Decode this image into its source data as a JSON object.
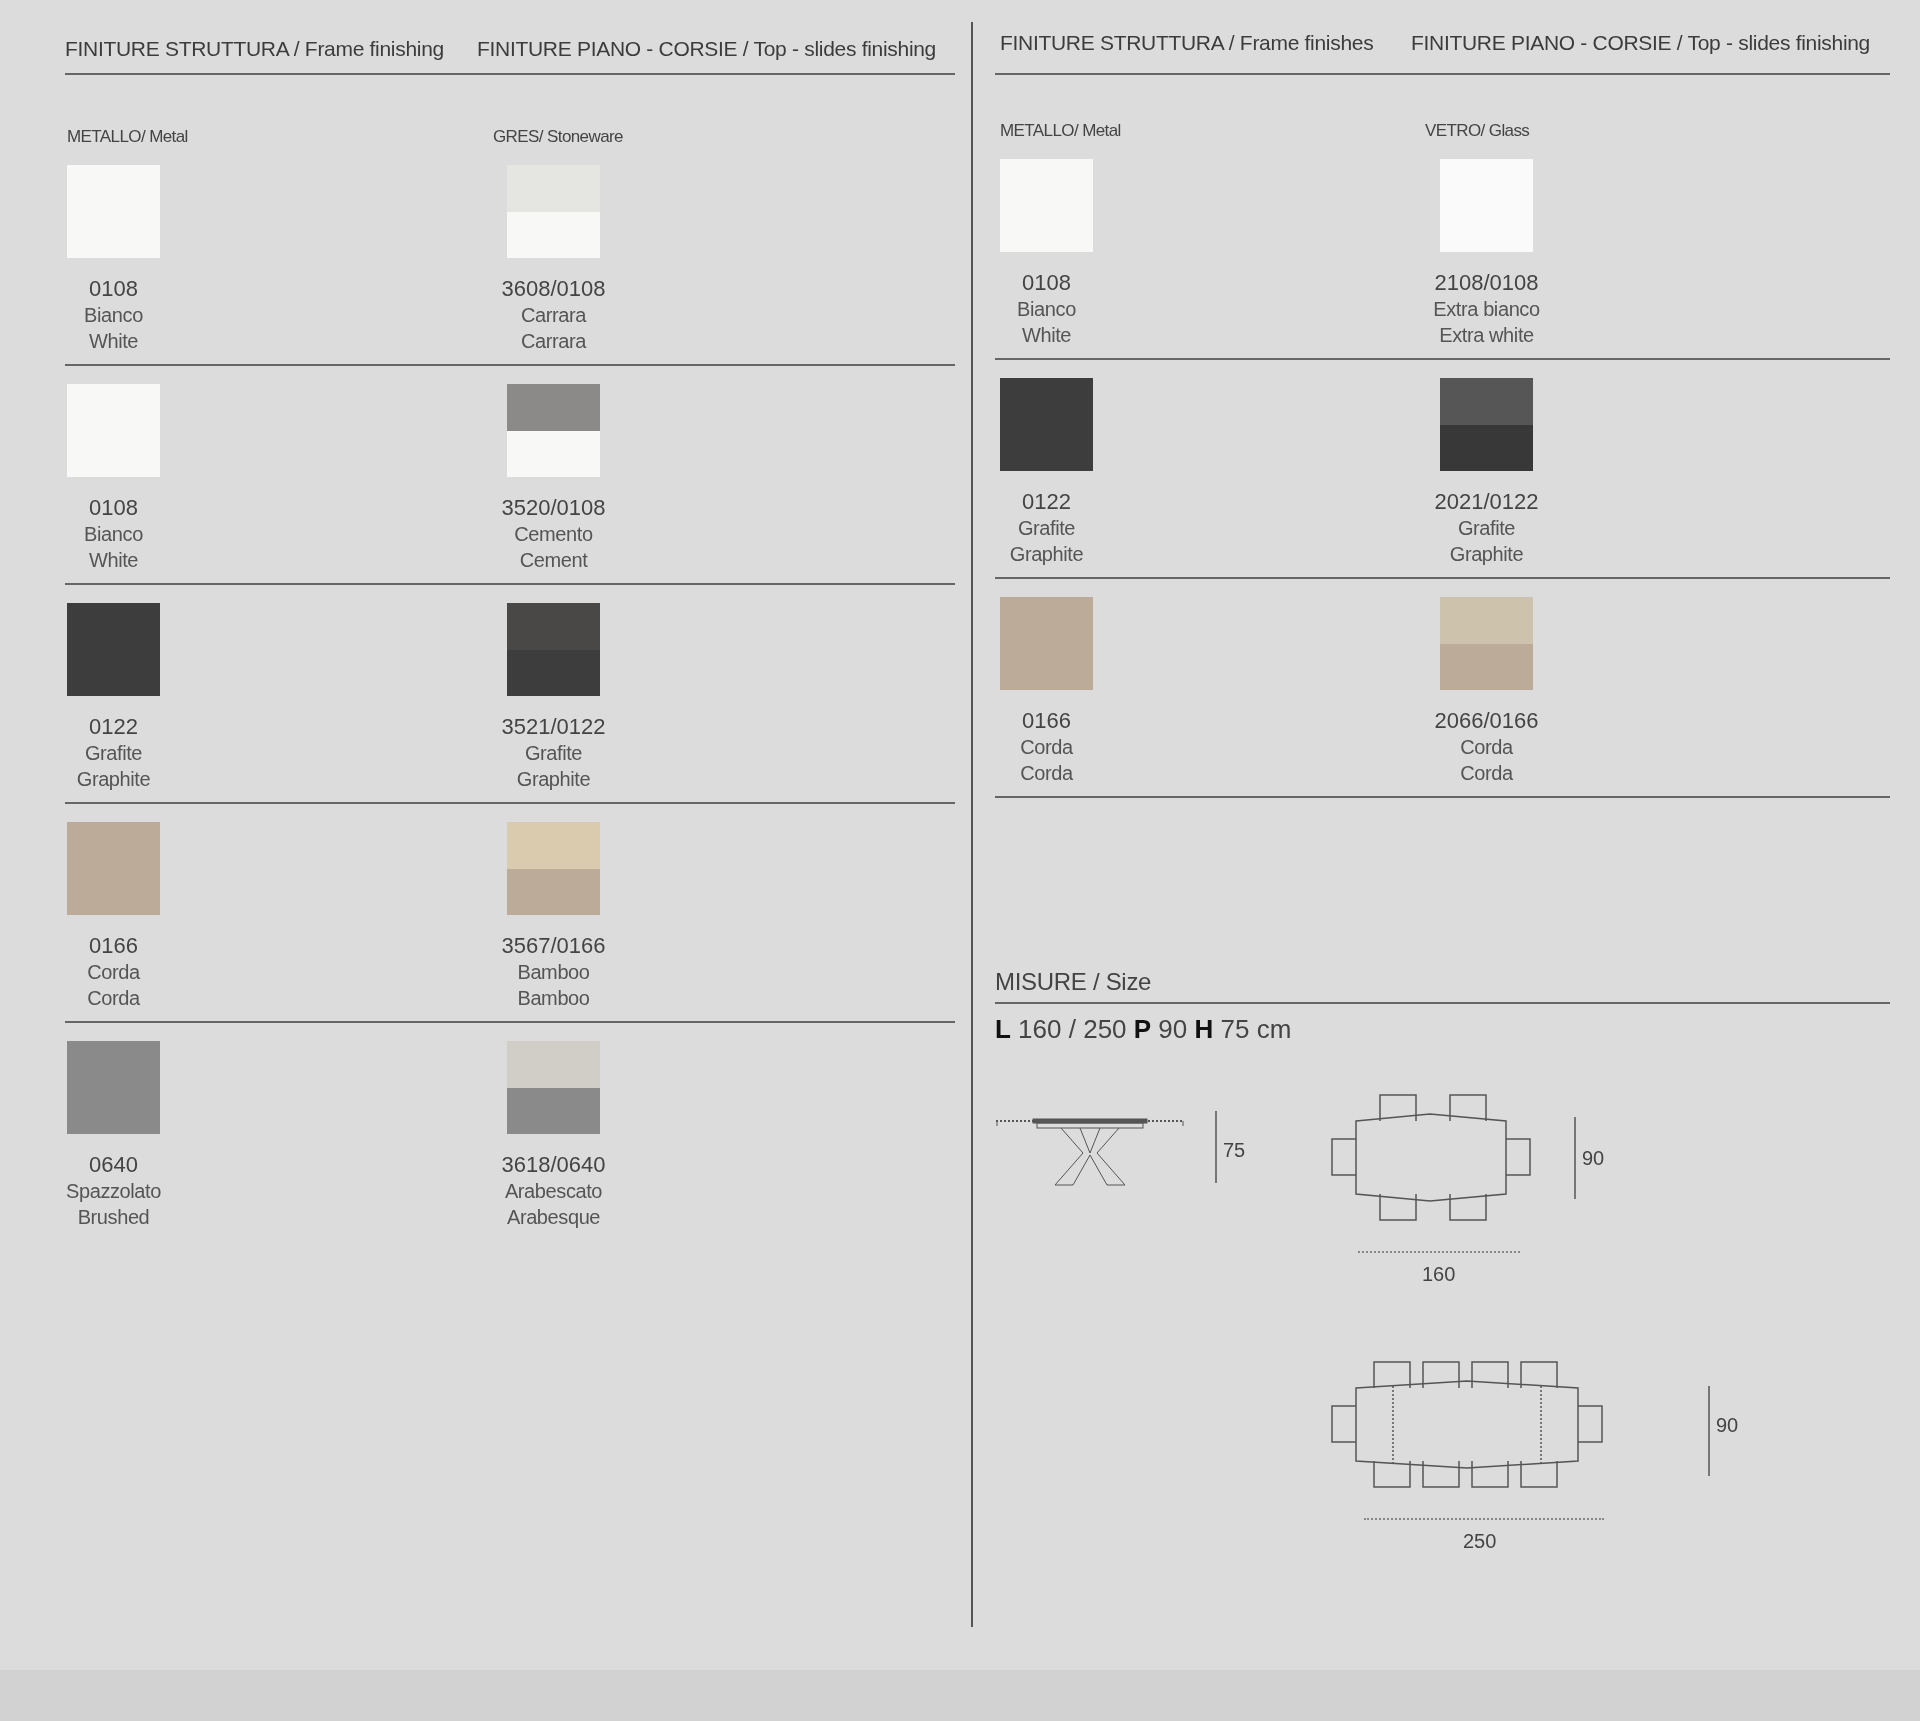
{
  "panels": [
    {
      "headings": [
        "FINITURE STRUTTURA / Frame finishing",
        "FINITURE PIANO - CORSIE / Top - slides finishing"
      ],
      "materials": [
        "METALLO/ Metal",
        "GRES/ Stoneware"
      ],
      "rows": [
        {
          "cells": [
            {
              "kind": "solid",
              "code": "0108",
              "name_it": "Bianco",
              "name_en": "White",
              "color": "#f8f8f7"
            },
            {
              "kind": "split",
              "code": "3608/0108",
              "name_it": "Carrara",
              "name_en": "Carrara",
              "halves": [
                {
                  "color": "#e5e5e1"
                },
                {
                  "color": "#f8f8f7"
                }
              ]
            }
          ]
        },
        {
          "cells": [
            {
              "kind": "solid",
              "code": "0108",
              "name_it": "Bianco",
              "name_en": "White",
              "color": "#f8f8f7"
            },
            {
              "kind": "split",
              "code": "3520/0108",
              "name_it": "Cemento",
              "name_en": "Cement",
              "halves": [
                {
                  "color": "#8b8a88"
                },
                {
                  "color": "#f8f8f7"
                }
              ]
            }
          ]
        },
        {
          "cells": [
            {
              "kind": "solid",
              "code": "0122",
              "name_it": "Grafite",
              "name_en": "Graphite",
              "color": "#3d3d3d"
            },
            {
              "kind": "split",
              "code": "3521/0122",
              "name_it": "Grafite",
              "name_en": "Graphite",
              "halves": [
                {
                  "color": "#4a4846"
                },
                {
                  "color": "#3d3d3d"
                }
              ]
            }
          ]
        },
        {
          "cells": [
            {
              "kind": "solid",
              "code": "0166",
              "name_it": "Corda",
              "name_en": "Corda",
              "color": "#bcab98"
            },
            {
              "kind": "split",
              "code": "3567/0166",
              "name_it": "Bamboo",
              "name_en": "Bamboo",
              "halves": [
                {
                  "color": "#dacaae"
                },
                {
                  "color": "#bcab98"
                }
              ]
            }
          ]
        },
        {
          "cells": [
            {
              "kind": "solid",
              "code": "0640",
              "name_it": "Spazzolato",
              "name_en": "Brushed",
              "color": "#8a8a8a"
            },
            {
              "kind": "split",
              "code": "3618/0640",
              "name_it": "Arabescato",
              "name_en": "Arabesque",
              "halves": [
                {
                  "color": "#d0cec7"
                },
                {
                  "color": "#8a8a8a"
                }
              ]
            }
          ]
        }
      ]
    },
    {
      "headings": [
        "FINITURE STRUTTURA / Frame finishes",
        "FINITURE PIANO - CORSIE / Top - slides finishing"
      ],
      "materials": [
        "METALLO/ Metal",
        "VETRO/ Glass"
      ],
      "rows": [
        {
          "cells": [
            {
              "kind": "solid",
              "code": "0108",
              "name_it": "Bianco",
              "name_en": "White",
              "color": "#f8f8f7"
            },
            {
              "kind": "solid",
              "code": "2108/0108",
              "name_it": "Extra bianco",
              "name_en": "Extra white",
              "color": "#fafafa"
            }
          ]
        },
        {
          "cells": [
            {
              "kind": "solid",
              "code": "0122",
              "name_it": "Grafite",
              "name_en": "Graphite",
              "color": "#3d3d3d"
            },
            {
              "kind": "split",
              "code": "2021/0122",
              "name_it": "Grafite",
              "name_en": "Graphite",
              "halves": [
                {
                  "color": "#565656"
                },
                {
                  "color": "#383838"
                }
              ]
            }
          ]
        },
        {
          "cells": [
            {
              "kind": "solid",
              "code": "0166",
              "name_it": "Corda",
              "name_en": "Corda",
              "color": "#bcab98"
            },
            {
              "kind": "split",
              "code": "2066/0166",
              "name_it": "Corda",
              "name_en": "Corda",
              "halves": [
                {
                  "color": "#cdc3ad"
                },
                {
                  "color": "#bcab98"
                }
              ]
            }
          ]
        }
      ]
    }
  ],
  "size": {
    "title": "MISURE / Size",
    "dimensions": "**L** 160 / 250 **P** 90 **H** 75 cm",
    "drawings": [
      {
        "kind": "side",
        "height_label": "75"
      },
      {
        "kind": "compact",
        "depth_label": "90",
        "length_label": "160"
      },
      {
        "kind": "extended",
        "depth_label": "90",
        "length_label": "250"
      }
    ]
  }
}
